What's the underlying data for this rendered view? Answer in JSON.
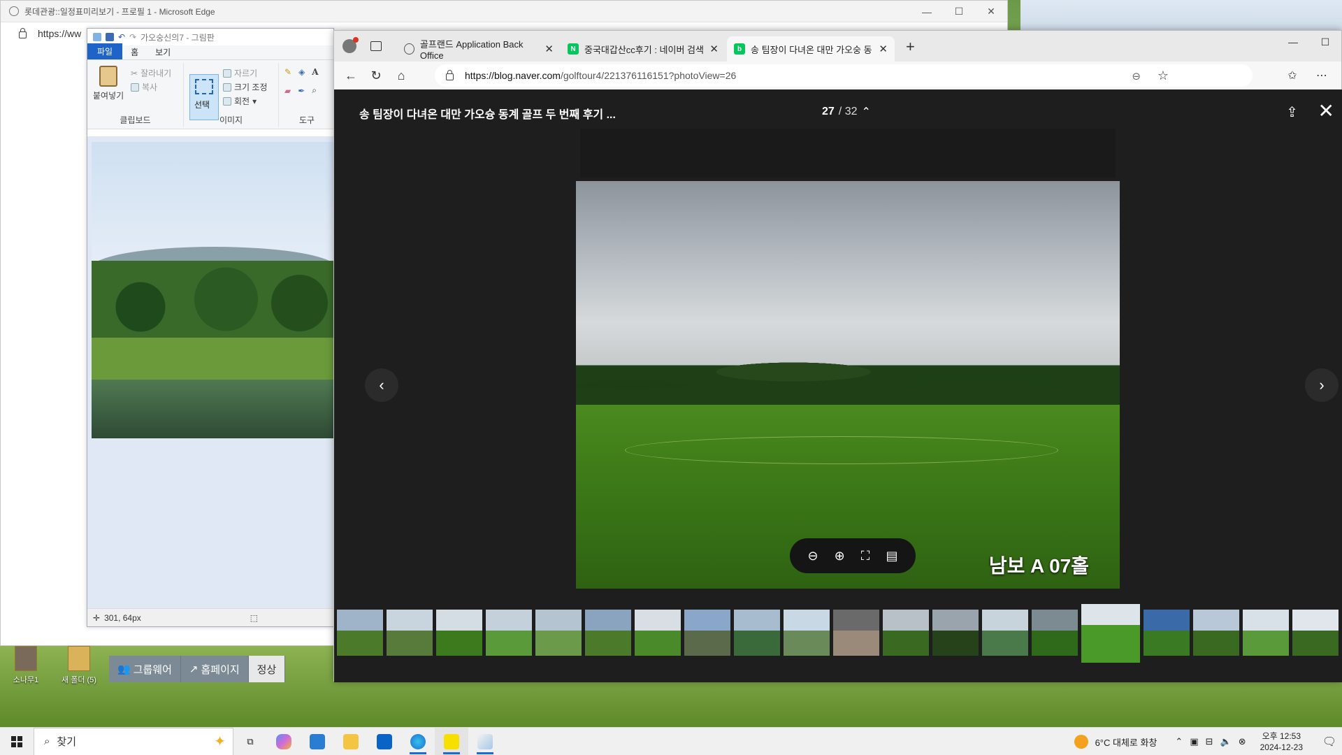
{
  "back_edge": {
    "title": "롯데관광::일정표미리보기 - 프로필 1 - Microsoft Edge",
    "address": "https://ww"
  },
  "paint": {
    "title": "가오숭신의7 - 그림판",
    "tabs": [
      "파일",
      "홈",
      "보기"
    ],
    "clipboard": {
      "paste": "붙여넣기",
      "cut": "잘라내기",
      "copy": "복사",
      "label": "클립보드"
    },
    "image": {
      "select": "선택",
      "crop": "자르기",
      "resize": "크기 조정",
      "rotate": "회전",
      "label": "이미지"
    },
    "tools_label": "도구",
    "status_pos": "301, 64px"
  },
  "fragment_bar": {
    "groupware": "그룹웨어",
    "homepage": "홈페이지",
    "normal": "정상"
  },
  "desktop_icons": [
    "소나무1",
    "새 폴더 (5)"
  ],
  "edge": {
    "tabs": [
      {
        "label": "골프랜드 Application Back Office",
        "icon": "globe-icon"
      },
      {
        "label": "중국대갑산cc후기 : 네이버 검색",
        "icon": "naver-icon"
      },
      {
        "label": "송 팀장이 다녀온 대만 가오숭 동",
        "icon": "blog-icon"
      }
    ],
    "url_host": "https://blog.naver.com",
    "url_rest": "/golftour4/221376116151?photoView=26"
  },
  "viewer": {
    "title": "송 팀장이 다녀온 대만 가오슝 동계 골프 두 번째 후기 ...",
    "current": "27",
    "total": "/ 32",
    "photo_label": "남보 A 07홀",
    "thumbs": [
      [
        "#9fb4c8",
        "#4a7a2a"
      ],
      [
        "#c8d4de",
        "#587a3a"
      ],
      [
        "#d4dce4",
        "#3d7a1e"
      ],
      [
        "#c4d0da",
        "#5a9a3a"
      ],
      [
        "#b4c4d0",
        "#6a9a4a"
      ],
      [
        "#8aa4c0",
        "#4a7a2a"
      ],
      [
        "#d8dee4",
        "#4a8a2a"
      ],
      [
        "#8aa6c8",
        "#5a6a4a"
      ],
      [
        "#a8bcd0",
        "#3a6a3a"
      ],
      [
        "#c8d8e4",
        "#6a8a5a"
      ],
      [
        "#6a6a6a",
        "#9a8a7a"
      ],
      [
        "#b8c0c8",
        "#3a6a22"
      ],
      [
        "#9aa4ac",
        "#26421a"
      ],
      [
        "#c8d4dc",
        "#4a7a4a"
      ],
      [
        "#7c8a92",
        "#2e6a1a"
      ],
      [
        "#dde4ea",
        "#4a9a2a"
      ],
      [
        "#3a6aa8",
        "#3a7a22"
      ],
      [
        "#b8c8d8",
        "#3a6a22"
      ],
      [
        "#d8e0e8",
        "#5a9a3a"
      ],
      [
        "#e0e6ec",
        "#3a6a22"
      ]
    ]
  },
  "taskbar": {
    "search": "찾기",
    "weather": "6°C  대체로 화창",
    "time": "오후 12:53",
    "date": "2024-12-23"
  }
}
